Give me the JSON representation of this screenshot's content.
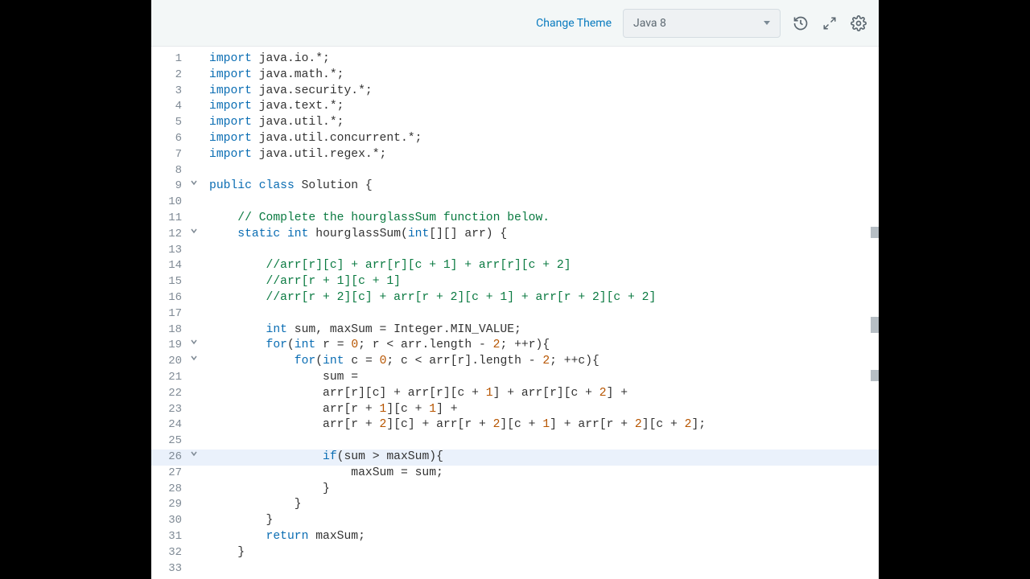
{
  "toolbar": {
    "change_theme_label": "Change Theme",
    "language_selected": "Java 8",
    "history_icon": "history-icon",
    "fullscreen_icon": "fullscreen-icon",
    "settings_icon": "gear-icon"
  },
  "editor": {
    "highlighted_line": 26,
    "fold_lines": [
      9,
      12,
      19,
      20,
      26
    ],
    "lines": [
      {
        "n": 1,
        "tokens": [
          {
            "t": "import",
            "c": "kw"
          },
          {
            "t": " java.io.*;",
            "c": "ident"
          }
        ]
      },
      {
        "n": 2,
        "tokens": [
          {
            "t": "import",
            "c": "kw"
          },
          {
            "t": " java.math.*;",
            "c": "ident"
          }
        ]
      },
      {
        "n": 3,
        "tokens": [
          {
            "t": "import",
            "c": "kw"
          },
          {
            "t": " java.security.*;",
            "c": "ident"
          }
        ]
      },
      {
        "n": 4,
        "tokens": [
          {
            "t": "import",
            "c": "kw"
          },
          {
            "t": " java.text.*;",
            "c": "ident"
          }
        ]
      },
      {
        "n": 5,
        "tokens": [
          {
            "t": "import",
            "c": "kw"
          },
          {
            "t": " java.util.*;",
            "c": "ident"
          }
        ]
      },
      {
        "n": 6,
        "tokens": [
          {
            "t": "import",
            "c": "kw"
          },
          {
            "t": " java.util.concurrent.*;",
            "c": "ident"
          }
        ]
      },
      {
        "n": 7,
        "tokens": [
          {
            "t": "import",
            "c": "kw"
          },
          {
            "t": " java.util.regex.*;",
            "c": "ident"
          }
        ]
      },
      {
        "n": 8,
        "tokens": []
      },
      {
        "n": 9,
        "tokens": [
          {
            "t": "public",
            "c": "kw"
          },
          {
            "t": " ",
            "c": "ident"
          },
          {
            "t": "class",
            "c": "kw"
          },
          {
            "t": " Solution {",
            "c": "ident"
          }
        ]
      },
      {
        "n": 10,
        "tokens": []
      },
      {
        "n": 11,
        "tokens": [
          {
            "t": "    ",
            "c": "ident"
          },
          {
            "t": "// Complete the hourglassSum function below.",
            "c": "cm"
          }
        ]
      },
      {
        "n": 12,
        "tokens": [
          {
            "t": "    ",
            "c": "ident"
          },
          {
            "t": "static",
            "c": "kw"
          },
          {
            "t": " ",
            "c": "ident"
          },
          {
            "t": "int",
            "c": "kw"
          },
          {
            "t": " hourglassSum(",
            "c": "ident"
          },
          {
            "t": "int",
            "c": "kw"
          },
          {
            "t": "[][] arr) {",
            "c": "ident"
          }
        ]
      },
      {
        "n": 13,
        "tokens": []
      },
      {
        "n": 14,
        "tokens": [
          {
            "t": "        ",
            "c": "ident"
          },
          {
            "t": "//arr[r][c] + arr[r][c + 1] + arr[r][c + 2]",
            "c": "cm"
          }
        ]
      },
      {
        "n": 15,
        "tokens": [
          {
            "t": "        ",
            "c": "ident"
          },
          {
            "t": "//arr[r + 1][c + 1]",
            "c": "cm"
          }
        ]
      },
      {
        "n": 16,
        "tokens": [
          {
            "t": "        ",
            "c": "ident"
          },
          {
            "t": "//arr[r + 2][c] + arr[r + 2][c + 1] + arr[r + 2][c + 2]",
            "c": "cm"
          }
        ]
      },
      {
        "n": 17,
        "tokens": []
      },
      {
        "n": 18,
        "tokens": [
          {
            "t": "        ",
            "c": "ident"
          },
          {
            "t": "int",
            "c": "kw"
          },
          {
            "t": " sum, maxSum = Integer.MIN_VALUE;",
            "c": "ident"
          }
        ]
      },
      {
        "n": 19,
        "tokens": [
          {
            "t": "        ",
            "c": "ident"
          },
          {
            "t": "for",
            "c": "kw"
          },
          {
            "t": "(",
            "c": "ident"
          },
          {
            "t": "int",
            "c": "kw"
          },
          {
            "t": " r = ",
            "c": "ident"
          },
          {
            "t": "0",
            "c": "num"
          },
          {
            "t": "; r < arr.length - ",
            "c": "ident"
          },
          {
            "t": "2",
            "c": "num"
          },
          {
            "t": "; ++r){",
            "c": "ident"
          }
        ]
      },
      {
        "n": 20,
        "tokens": [
          {
            "t": "            ",
            "c": "ident"
          },
          {
            "t": "for",
            "c": "kw"
          },
          {
            "t": "(",
            "c": "ident"
          },
          {
            "t": "int",
            "c": "kw"
          },
          {
            "t": " c = ",
            "c": "ident"
          },
          {
            "t": "0",
            "c": "num"
          },
          {
            "t": "; c < arr[r].length - ",
            "c": "ident"
          },
          {
            "t": "2",
            "c": "num"
          },
          {
            "t": "; ++c){",
            "c": "ident"
          }
        ]
      },
      {
        "n": 21,
        "tokens": [
          {
            "t": "                sum =",
            "c": "ident"
          }
        ]
      },
      {
        "n": 22,
        "tokens": [
          {
            "t": "                arr[r][c] + arr[r][c + ",
            "c": "ident"
          },
          {
            "t": "1",
            "c": "num"
          },
          {
            "t": "] + arr[r][c + ",
            "c": "ident"
          },
          {
            "t": "2",
            "c": "num"
          },
          {
            "t": "] +",
            "c": "ident"
          }
        ]
      },
      {
        "n": 23,
        "tokens": [
          {
            "t": "                arr[r + ",
            "c": "ident"
          },
          {
            "t": "1",
            "c": "num"
          },
          {
            "t": "][c + ",
            "c": "ident"
          },
          {
            "t": "1",
            "c": "num"
          },
          {
            "t": "] +",
            "c": "ident"
          }
        ]
      },
      {
        "n": 24,
        "tokens": [
          {
            "t": "                arr[r + ",
            "c": "ident"
          },
          {
            "t": "2",
            "c": "num"
          },
          {
            "t": "][c] + arr[r + ",
            "c": "ident"
          },
          {
            "t": "2",
            "c": "num"
          },
          {
            "t": "][c + ",
            "c": "ident"
          },
          {
            "t": "1",
            "c": "num"
          },
          {
            "t": "] + arr[r + ",
            "c": "ident"
          },
          {
            "t": "2",
            "c": "num"
          },
          {
            "t": "][c + ",
            "c": "ident"
          },
          {
            "t": "2",
            "c": "num"
          },
          {
            "t": "];",
            "c": "ident"
          }
        ]
      },
      {
        "n": 25,
        "tokens": []
      },
      {
        "n": 26,
        "tokens": [
          {
            "t": "                ",
            "c": "ident"
          },
          {
            "t": "if",
            "c": "kw"
          },
          {
            "t": "(sum > maxSum){",
            "c": "ident"
          }
        ]
      },
      {
        "n": 27,
        "tokens": [
          {
            "t": "                    maxSum = sum;",
            "c": "ident"
          }
        ]
      },
      {
        "n": 28,
        "tokens": [
          {
            "t": "                }",
            "c": "ident"
          }
        ]
      },
      {
        "n": 29,
        "tokens": [
          {
            "t": "            }",
            "c": "ident"
          }
        ]
      },
      {
        "n": 30,
        "tokens": [
          {
            "t": "        }",
            "c": "ident"
          }
        ]
      },
      {
        "n": 31,
        "tokens": [
          {
            "t": "        ",
            "c": "ident"
          },
          {
            "t": "return",
            "c": "kw"
          },
          {
            "t": " maxSum;",
            "c": "ident"
          }
        ]
      },
      {
        "n": 32,
        "tokens": [
          {
            "t": "    }",
            "c": "ident"
          }
        ]
      },
      {
        "n": 33,
        "tokens": []
      }
    ]
  }
}
